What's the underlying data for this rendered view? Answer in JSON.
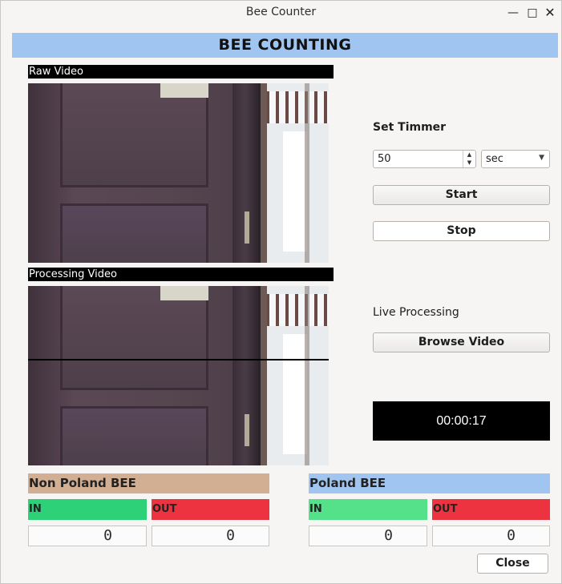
{
  "window": {
    "title": "Bee Counter"
  },
  "banner": {
    "text": "BEE COUNTING"
  },
  "raw_video": {
    "label": "Raw Video"
  },
  "processing_video": {
    "label": "Processing Video"
  },
  "timer_settings": {
    "label": "Set Timmer",
    "value": "50",
    "unit": "sec",
    "start_label": "Start",
    "stop_label": "Stop"
  },
  "live": {
    "label": "Live Processing",
    "browse_label": "Browse Video",
    "elapsed": "00:00:17"
  },
  "non_poland": {
    "title": "Non Poland BEE",
    "in_label": "IN",
    "out_label": "OUT",
    "in_count": "0",
    "out_count": "0"
  },
  "poland": {
    "title": "Poland BEE",
    "in_label": "IN",
    "out_label": "OUT",
    "in_count": "0",
    "out_count": "0"
  },
  "close_label": "Close",
  "colors": {
    "banner": "#9fc5f0",
    "non_poland_header": "#d2ae93",
    "poland_header": "#9fc5f0",
    "in_green_1": "#2dd177",
    "in_green_2": "#55e08a",
    "out_red": "#ee3340"
  }
}
